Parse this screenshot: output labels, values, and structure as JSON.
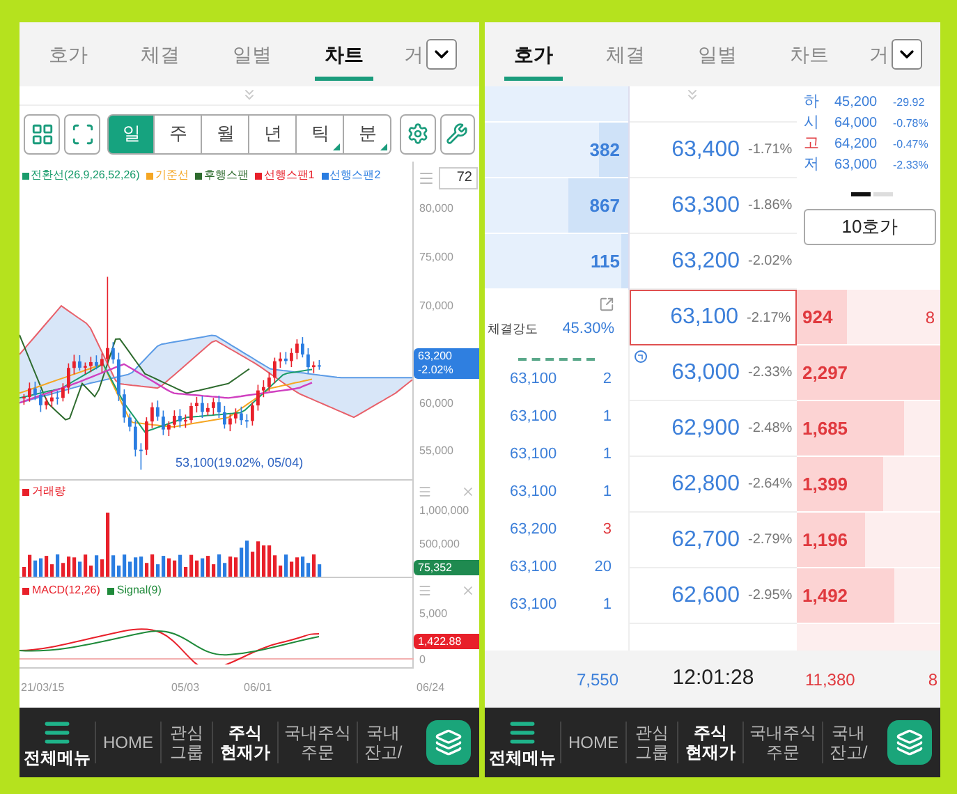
{
  "left_phone": {
    "tabs": [
      {
        "label": "호가",
        "selected": false
      },
      {
        "label": "체결",
        "selected": false
      },
      {
        "label": "일별",
        "selected": false
      },
      {
        "label": "차트",
        "selected": true
      },
      {
        "label": "거",
        "selected": false
      }
    ],
    "periods": [
      {
        "label": "일",
        "selected": true,
        "submenu": false
      },
      {
        "label": "주",
        "selected": false,
        "submenu": false
      },
      {
        "label": "월",
        "selected": false,
        "submenu": false
      },
      {
        "label": "년",
        "selected": false,
        "submenu": false
      },
      {
        "label": "틱",
        "selected": false,
        "submenu": true
      },
      {
        "label": "분",
        "selected": false,
        "submenu": true
      }
    ],
    "legend": [
      {
        "label": "전환선(26,9,26,52,26)",
        "color": "#1a9c6c"
      },
      {
        "label": "기준선",
        "color": "#f5a623"
      },
      {
        "label": "후행스팬",
        "color": "#2e6b2e"
      },
      {
        "label": "선행스팬1",
        "color": "#e8202a"
      },
      {
        "label": "선행스팬2",
        "color": "#2a7de1"
      }
    ],
    "bar_count": "72",
    "price_axis": [
      "80,000",
      "75,000",
      "70,000",
      "60,000",
      "55,000"
    ],
    "current_price": {
      "price": "63,200",
      "change": "-2.02%"
    },
    "low_annotation": "53,100(19.02%, 05/04)",
    "volume": {
      "legend": {
        "label": "거래량",
        "color": "#e8202a"
      },
      "axis": [
        "1,000,000",
        "500,000"
      ],
      "current": "75,352"
    },
    "macd": {
      "legend": [
        {
          "label": "MACD(12,26)",
          "color": "#e8202a"
        },
        {
          "label": "Signal(9)",
          "color": "#1f8a3a"
        }
      ],
      "axis": [
        "5,000",
        "0"
      ],
      "current": "1,422.88"
    },
    "dates": [
      "21/03/15",
      "05/03",
      "06/01",
      "06/24"
    ],
    "bottom_nav": {
      "menu": "전체메뉴",
      "items": [
        {
          "lines": [
            "HOME"
          ],
          "selected": false
        },
        {
          "lines": [
            "관심",
            "그룹"
          ],
          "selected": false
        },
        {
          "lines": [
            "주식",
            "현재가"
          ],
          "selected": true
        },
        {
          "lines": [
            "국내주식",
            "주문"
          ],
          "selected": false
        },
        {
          "lines": [
            "국내",
            "잔고/"
          ],
          "selected": false
        }
      ]
    }
  },
  "right_phone": {
    "tabs": [
      {
        "label": "호가",
        "selected": true
      },
      {
        "label": "체결",
        "selected": false
      },
      {
        "label": "일별",
        "selected": false
      },
      {
        "label": "차트",
        "selected": false
      },
      {
        "label": "거",
        "selected": false
      }
    ],
    "asks": [
      {
        "quantity": "382",
        "price": "63,400",
        "change": "-1.71%",
        "level": 0.2
      },
      {
        "quantity": "867",
        "price": "63,300",
        "change": "-1.86%",
        "level": 0.42
      },
      {
        "quantity": "115",
        "price": "63,200",
        "change": "-2.02%",
        "level": 0.05
      }
    ],
    "summary": [
      {
        "label": "하",
        "color": "#3c7fd9",
        "price": "45,200",
        "change": "-29.92"
      },
      {
        "label": "시",
        "color": "#3c7fd9",
        "price": "64,000",
        "change": "-0.78%"
      },
      {
        "label": "고",
        "color": "#e0393e",
        "price": "64,200",
        "change": "-0.47%"
      },
      {
        "label": "저",
        "color": "#3c7fd9",
        "price": "63,000",
        "change": "-2.33%"
      }
    ],
    "pages": [
      {
        "selected": true
      },
      {
        "selected": false
      }
    ],
    "depth_button": "10호가",
    "strength": {
      "label": "체결강도",
      "value": "45.30%"
    },
    "trades": [
      {
        "price": "63,100",
        "volume": "2",
        "uptick": false
      },
      {
        "price": "63,100",
        "volume": "1",
        "uptick": false
      },
      {
        "price": "63,100",
        "volume": "1",
        "uptick": false
      },
      {
        "price": "63,100",
        "volume": "1",
        "uptick": false
      },
      {
        "price": "63,200",
        "volume": "3",
        "uptick": true
      },
      {
        "price": "63,100",
        "volume": "20",
        "uptick": false
      },
      {
        "price": "63,100",
        "volume": "1",
        "uptick": false
      }
    ],
    "bids": [
      {
        "price": "63,100",
        "change": "-2.17%",
        "quantity": "924",
        "level": 0.35,
        "current": true,
        "column_2": "8"
      },
      {
        "price": "63,000",
        "change": "-2.33%",
        "quantity": "2,297",
        "level": 1.0,
        "current": false
      },
      {
        "price": "62,900",
        "change": "-2.48%",
        "quantity": "1,685",
        "level": 0.75,
        "current": false
      },
      {
        "price": "62,800",
        "change": "-2.64%",
        "quantity": "1,399",
        "level": 0.6,
        "current": false
      },
      {
        "price": "62,700",
        "change": "-2.79%",
        "quantity": "1,196",
        "level": 0.48,
        "current": false
      },
      {
        "price": "62,600",
        "change": "-2.95%",
        "quantity": "1,492",
        "level": 0.68,
        "current": false
      }
    ],
    "footer": {
      "ask_total": "7,550",
      "time": "12:01:28",
      "bid_total": "11,380",
      "column_2": "8"
    },
    "bottom_nav": {
      "menu": "전체메뉴",
      "items": [
        {
          "lines": [
            "HOME"
          ],
          "selected": false
        },
        {
          "lines": [
            "관심",
            "그룹"
          ],
          "selected": false
        },
        {
          "lines": [
            "주식",
            "현재가"
          ],
          "selected": true
        },
        {
          "lines": [
            "국내주식",
            "주문"
          ],
          "selected": false
        },
        {
          "lines": [
            "국내",
            "잔고/"
          ],
          "selected": false
        }
      ]
    }
  }
}
